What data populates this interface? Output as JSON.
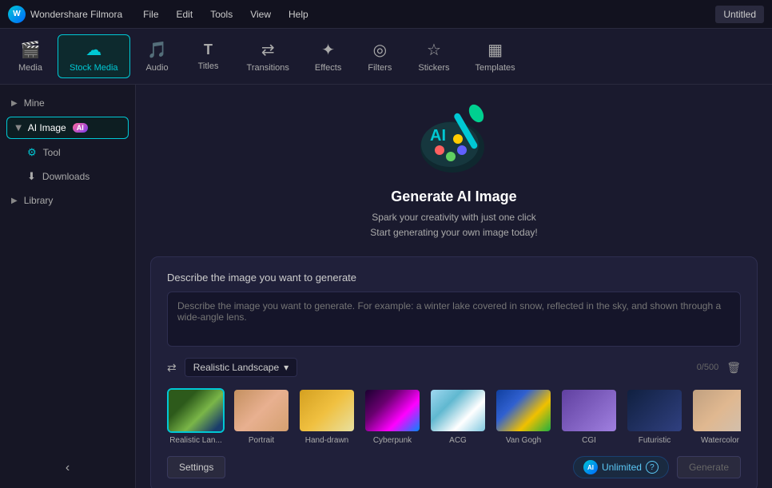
{
  "titlebar": {
    "app_name": "Wondershare Filmora",
    "menu_items": [
      "File",
      "Edit",
      "Tools",
      "View",
      "Help"
    ],
    "untitled_label": "Untitled"
  },
  "toolbar": {
    "items": [
      {
        "id": "media",
        "label": "Media",
        "icon": "🎬"
      },
      {
        "id": "stock-media",
        "label": "Stock Media",
        "icon": "☁"
      },
      {
        "id": "audio",
        "label": "Audio",
        "icon": "🎵"
      },
      {
        "id": "titles",
        "label": "Titles",
        "icon": "T"
      },
      {
        "id": "transitions",
        "label": "Transitions",
        "icon": "↔"
      },
      {
        "id": "effects",
        "label": "Effects",
        "icon": "✦"
      },
      {
        "id": "filters",
        "label": "Filters",
        "icon": "⊙"
      },
      {
        "id": "stickers",
        "label": "Stickers",
        "icon": "☆"
      },
      {
        "id": "templates",
        "label": "Templates",
        "icon": "⊟"
      }
    ],
    "active": "stock-media"
  },
  "sidebar": {
    "mine_label": "Mine",
    "ai_image_label": "AI Image",
    "tool_label": "Tool",
    "downloads_label": "Downloads",
    "library_label": "Library"
  },
  "ai_image": {
    "title": "Generate AI Image",
    "subtitle_line1": "Spark your creativity with just one click",
    "subtitle_line2": "Start generating your own image today!",
    "card_header": "Describe the image you want to generate",
    "textarea_placeholder": "Describe the image you want to generate. For example: a winter lake covered in snow, reflected in the sky, and shown through a wide-angle lens.",
    "char_count": "0/500",
    "style_selector_label": "Realistic Landscape",
    "style_thumbnails": [
      {
        "id": "realistic-landscape",
        "label": "Realistic Lan...",
        "selected": true
      },
      {
        "id": "portrait",
        "label": "Portrait",
        "selected": false
      },
      {
        "id": "hand-drawn",
        "label": "Hand-drawn",
        "selected": false
      },
      {
        "id": "cyberpunk",
        "label": "Cyberpunk",
        "selected": false
      },
      {
        "id": "acg",
        "label": "ACG",
        "selected": false
      },
      {
        "id": "van-gogh",
        "label": "Van Gogh",
        "selected": false
      },
      {
        "id": "cgi",
        "label": "CGI",
        "selected": false
      },
      {
        "id": "futuristic",
        "label": "Futuristic",
        "selected": false
      },
      {
        "id": "watercolor",
        "label": "Watercolor",
        "selected": false
      }
    ],
    "settings_label": "Settings",
    "unlimited_label": "Unlimited",
    "generate_label": "Generate"
  }
}
